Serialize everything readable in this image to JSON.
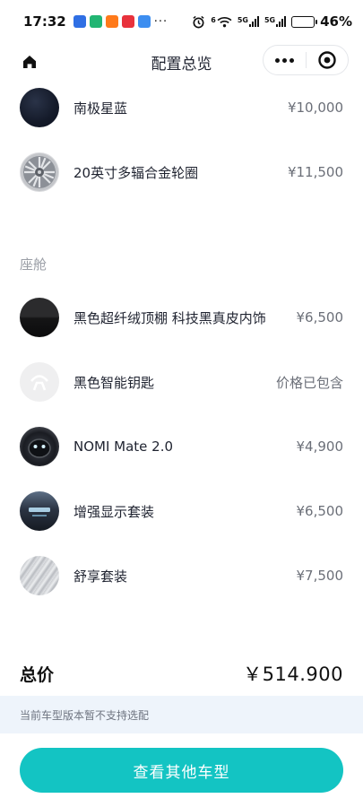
{
  "status_bar": {
    "time": "17:32",
    "more": "···",
    "network_1": "5G",
    "network_2": "5G",
    "wifi_label": "6",
    "battery_percent": "46%",
    "battery_level": 0.46,
    "app_icon_colors": [
      "#2f6fe4",
      "#22b573",
      "#ff7a1a",
      "#e8323c",
      "#3d8ef0"
    ]
  },
  "nav": {
    "title": "配置总览",
    "home_icon": "home-icon",
    "more_icon": "more-dots-icon",
    "target_icon": "target-icon"
  },
  "exterior_items": [
    {
      "name": "南极星蓝",
      "price": "¥10,000",
      "thumb": "navy-paint"
    },
    {
      "name": "20英寸多辐合金轮圈",
      "price": "¥11,500",
      "thumb": "alloy-wheel"
    }
  ],
  "cabin": {
    "section_label": "座舱",
    "items": [
      {
        "name": "黑色超纤绒顶棚 科技黑真皮内饰",
        "price": "¥6,500",
        "thumb": "black-interior"
      },
      {
        "name": "黑色智能钥匙",
        "price": "价格已包含",
        "thumb": "smart-key"
      },
      {
        "name": "NOMI Mate 2.0",
        "price": "¥4,900",
        "thumb": "nomi-mate"
      },
      {
        "name": "增强显示套装",
        "price": "¥6,500",
        "thumb": "hud-display"
      },
      {
        "name": "舒享套装",
        "price": "¥7,500",
        "thumb": "comfort-pack"
      }
    ]
  },
  "summary": {
    "total_label": "总价",
    "total_value": "￥514.900"
  },
  "notice": "当前车型版本暂不支持选配",
  "cta_label": "查看其他车型",
  "colors": {
    "accent": "#13c4c3",
    "notice_bg": "#eef4fb",
    "price_text": "#6b6f78",
    "section_label": "#9a9ea6"
  }
}
